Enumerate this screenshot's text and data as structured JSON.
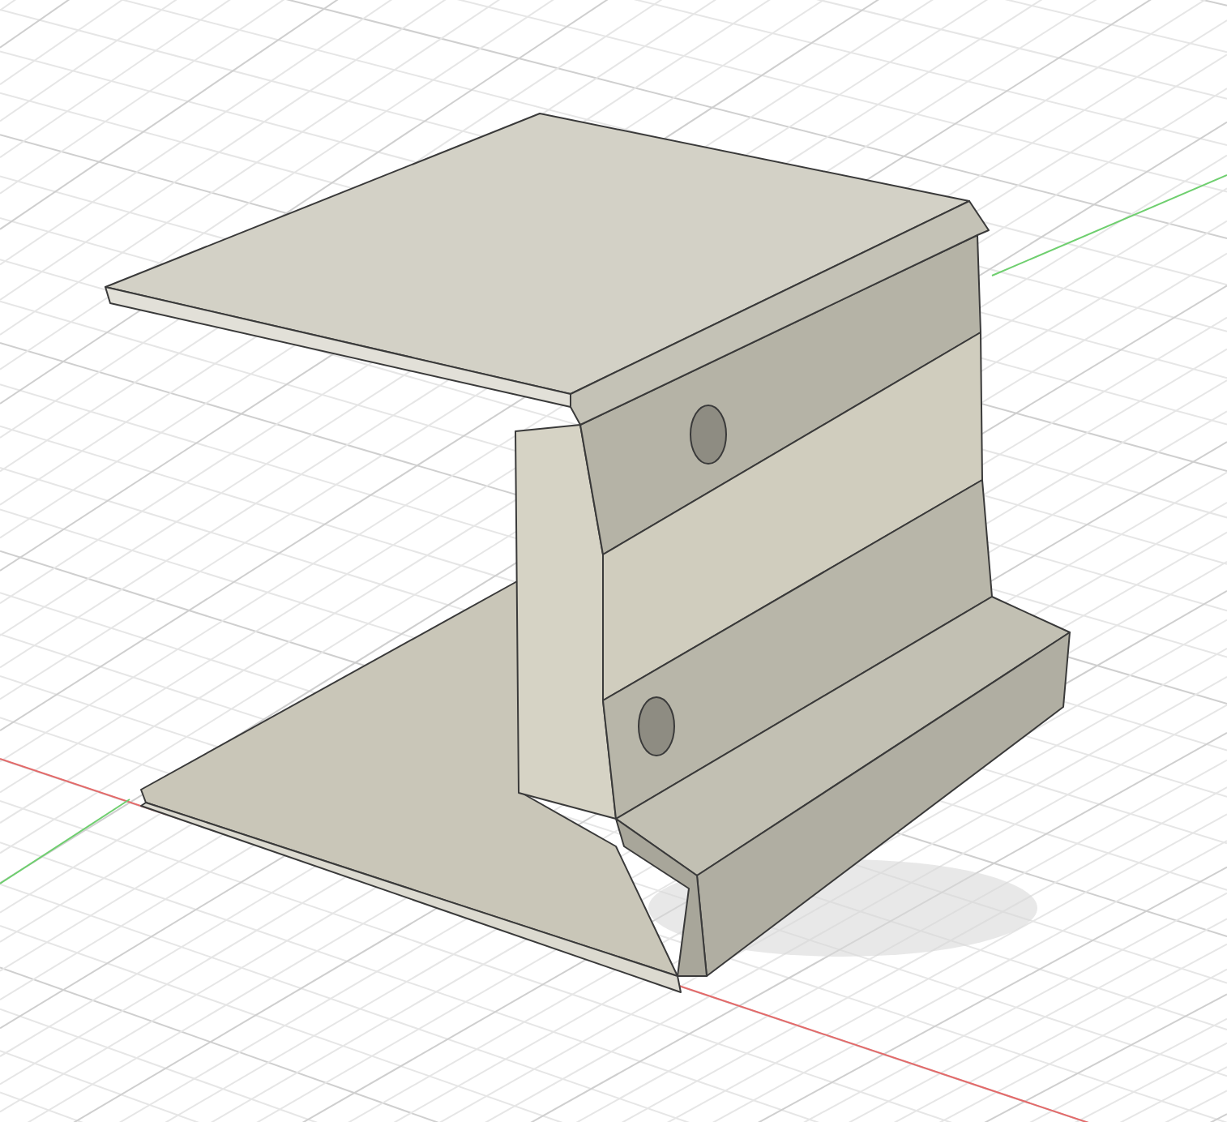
{
  "viewport": {
    "kind": "sheet-metal-bracket"
  }
}
